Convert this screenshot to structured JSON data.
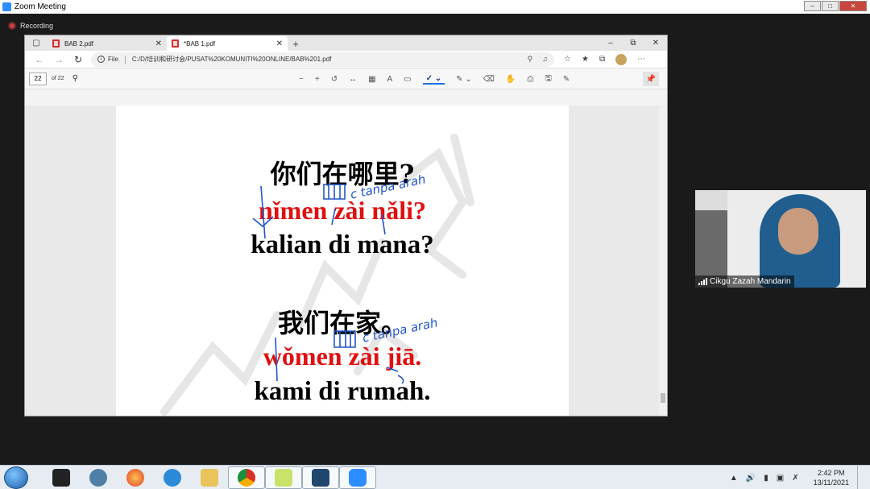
{
  "zoom": {
    "title": "Zoom Meeting",
    "recording_label": "Recording",
    "window_buttons": [
      "–",
      "□",
      "✕"
    ]
  },
  "browser": {
    "tabs": [
      {
        "label": "BAB 2.pdf",
        "active": false
      },
      {
        "label": "*BAB 1.pdf",
        "active": true
      }
    ],
    "address": {
      "scheme_label": "File",
      "url": "C:/D/培训和研讨会/PUSAT%20KOMUNITI%20ONLINE/BAB%201.pdf"
    },
    "pdf_toolbar": {
      "page_value": "22",
      "page_total": "of 22"
    }
  },
  "pdf_page": {
    "line1_hanzi": "你们在哪里?",
    "line1_pinyin": "nǐmen zài nǎli?",
    "line1_malay": "kalian di mana?",
    "line2_hanzi": "我们在家。",
    "line2_pinyin": "wǒmen zài jiā.",
    "line2_malay": "kami di rumah.",
    "annotation1": "c tanpa arah",
    "annotation2": "c tanpa arah",
    "colors": {
      "pinyin": "#e01010",
      "annotation": "#2255c8"
    }
  },
  "video": {
    "participant_name": "Cikgu Zazah Mandarin"
  },
  "taskbar": {
    "clock_time": "2:42 PM",
    "clock_date": "13/11/2021",
    "apps": [
      "dictionary-icon",
      "firefox-icon",
      "ie-icon",
      "explorer-icon",
      "chrome-icon",
      "folder-icon",
      "computer-icon",
      "zoom-icon"
    ]
  }
}
